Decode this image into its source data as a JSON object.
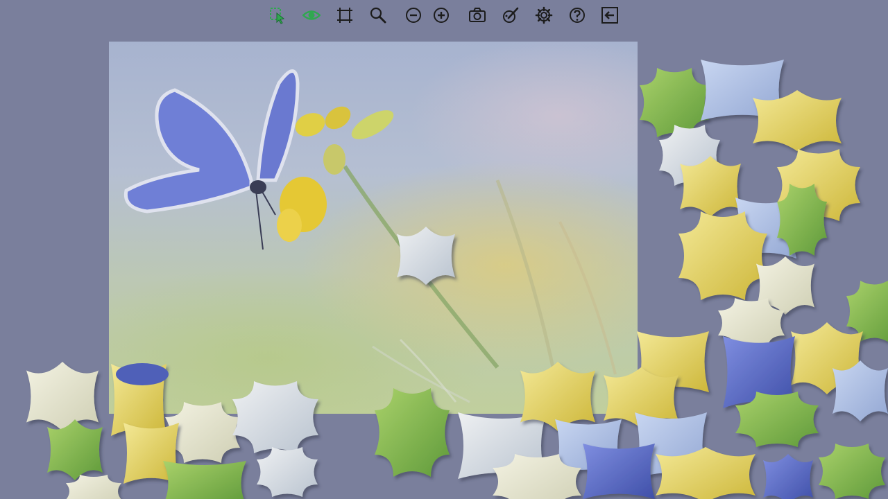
{
  "toolbar": {
    "tools": [
      {
        "name": "select-pieces-icon",
        "color": "#2fa84f"
      },
      {
        "name": "eye-icon",
        "color": "#2fa84f"
      },
      {
        "name": "crop-frame-icon",
        "color": "#1c1c1c"
      },
      {
        "name": "magnifier-icon",
        "color": "#1c1c1c"
      },
      {
        "name": "zoom-out-icon",
        "color": "#1c1c1c"
      },
      {
        "name": "zoom-in-icon",
        "color": "#1c1c1c"
      },
      {
        "name": "camera-icon",
        "color": "#1c1c1c"
      },
      {
        "name": "brush-icon",
        "color": "#1c1c1c"
      },
      {
        "name": "gear-icon",
        "color": "#1c1c1c"
      },
      {
        "name": "help-icon",
        "color": "#1c1c1c"
      },
      {
        "name": "exit-icon",
        "color": "#1c1c1c"
      }
    ]
  },
  "colors": {
    "background": "#7a7f9c",
    "butterfly": "#6f7fd6",
    "flower": "#e6cc3a",
    "piece_green": "#8fbf52",
    "piece_yellow": "#e8d86a",
    "piece_pale": "#dfe3e8",
    "piece_blue": "#b4c4e6",
    "piece_cream": "#ecebd6"
  }
}
